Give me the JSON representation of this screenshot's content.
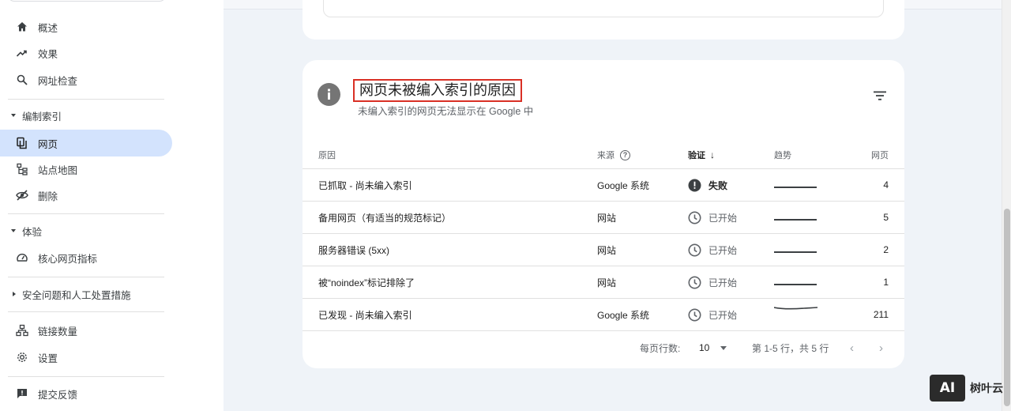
{
  "sidebar": {
    "items": [
      {
        "label": "概述",
        "icon": "home-icon"
      },
      {
        "label": "效果",
        "icon": "trending-up-icon"
      },
      {
        "label": "网址检查",
        "icon": "search-icon"
      }
    ],
    "index_section": "编制索引",
    "index_items": [
      {
        "label": "网页",
        "icon": "pages-icon"
      },
      {
        "label": "站点地图",
        "icon": "sitemap-icon"
      },
      {
        "label": "删除",
        "icon": "removal-icon"
      }
    ],
    "experience_section": "体验",
    "experience_items": [
      {
        "label": "核心网页指标",
        "icon": "speed-gauge-icon"
      }
    ],
    "security_section": "安全问题和人工处置措施",
    "bottom_items": [
      {
        "label": "链接数量",
        "icon": "links-icon"
      },
      {
        "label": "设置",
        "icon": "gear-icon"
      }
    ],
    "feedback": {
      "label": "提交反馈",
      "icon": "feedback-icon"
    }
  },
  "card": {
    "title": "网页未被编入索引的原因",
    "subtitle": "未编入索引的网页无法显示在 Google 中",
    "columns": {
      "reason": "原因",
      "source": "来源",
      "validation": "验证",
      "trend": "趋势",
      "pages": "网页"
    },
    "rows": [
      {
        "reason": "已抓取 - 尚未编入索引",
        "source": "Google 系统",
        "status": "失败",
        "status_type": "fail",
        "pages": "4"
      },
      {
        "reason": "备用网页（有适当的规范标记）",
        "source": "网站",
        "status": "已开始",
        "status_type": "started",
        "pages": "5"
      },
      {
        "reason": "服务器错误 (5xx)",
        "source": "网站",
        "status": "已开始",
        "status_type": "started",
        "pages": "2"
      },
      {
        "reason": "被“noindex”标记排除了",
        "source": "网站",
        "status": "已开始",
        "status_type": "started",
        "pages": "1"
      },
      {
        "reason": "已发现 - 尚未编入索引",
        "source": "Google 系统",
        "status": "已开始",
        "status_type": "started",
        "pages": "211"
      }
    ],
    "footer": {
      "rows_per_page_label": "每页行数:",
      "rows_per_page_value": "10",
      "range": "第 1-5 行，共 5 行"
    }
  },
  "watermark": {
    "logo": "AI",
    "text": "树叶云"
  },
  "colors": {
    "active_nav": "#d3e3fd",
    "highlight_border": "#d93025",
    "main_bg": "#eff3f8"
  }
}
